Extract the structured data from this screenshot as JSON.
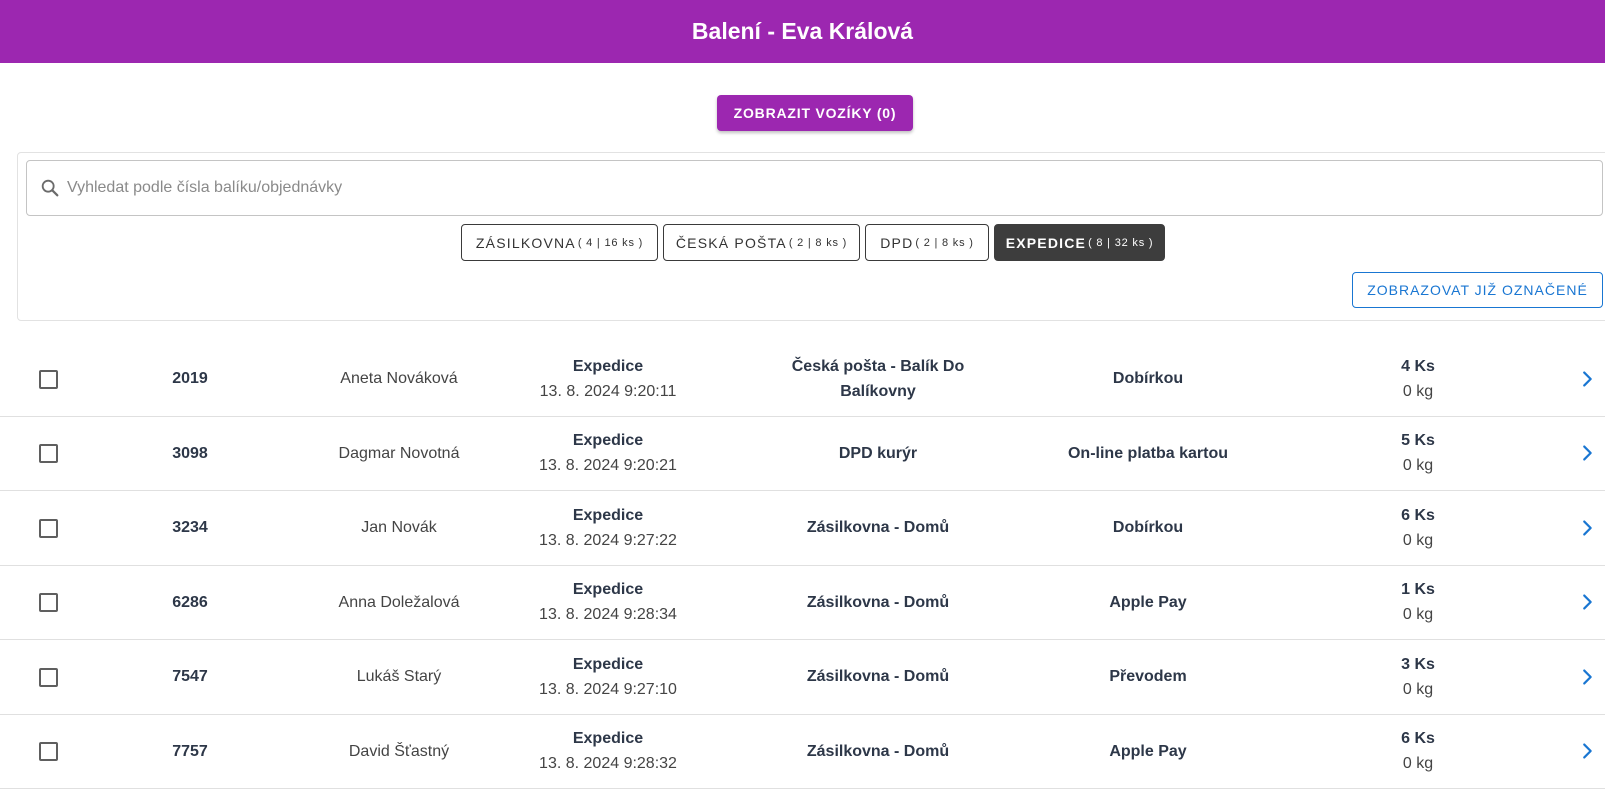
{
  "header": {
    "title": "Balení - Eva Králová"
  },
  "actions": {
    "carts_label": "ZOBRAZIT VOZÍKY (0)",
    "marked_label": "ZOBRAZOVAT JIŽ OZNAČENÉ"
  },
  "search": {
    "placeholder": "Vyhledat podle čísla balíku/objednávky",
    "value": ""
  },
  "tabs": [
    {
      "label": "ZÁSILKOVNA",
      "count": "( 4 | 16 ks )",
      "active": false
    },
    {
      "label": "ČESKÁ POŠTA",
      "count": "( 2 | 8 ks )",
      "active": false
    },
    {
      "label": "DPD",
      "count": "( 2 | 8 ks )",
      "active": false
    },
    {
      "label": "EXPEDICE",
      "count": "( 8 | 32 ks )",
      "active": true
    }
  ],
  "orders": [
    {
      "id": "2019",
      "customer": "Aneta Nováková",
      "status": "Expedice",
      "date": "13. 8. 2024 9:20:11",
      "carrier": "Česká pošta - Balík Do Balíkovny",
      "payment": "Dobírkou",
      "quantity": "4 Ks",
      "weight": "0 kg"
    },
    {
      "id": "3098",
      "customer": "Dagmar Novotná",
      "status": "Expedice",
      "date": "13. 8. 2024 9:20:21",
      "carrier": "DPD kurýr",
      "payment": "On-line platba kartou",
      "quantity": "5 Ks",
      "weight": "0 kg"
    },
    {
      "id": "3234",
      "customer": "Jan Novák",
      "status": "Expedice",
      "date": "13. 8. 2024 9:27:22",
      "carrier": "Zásilkovna - Domů",
      "payment": "Dobírkou",
      "quantity": "6 Ks",
      "weight": "0 kg"
    },
    {
      "id": "6286",
      "customer": "Anna Doležalová",
      "status": "Expedice",
      "date": "13. 8. 2024 9:28:34",
      "carrier": "Zásilkovna - Domů",
      "payment": "Apple Pay",
      "quantity": "1 Ks",
      "weight": "0 kg"
    },
    {
      "id": "7547",
      "customer": "Lukáš Starý",
      "status": "Expedice",
      "date": "13. 8. 2024 9:27:10",
      "carrier": "Zásilkovna - Domů",
      "payment": "Převodem",
      "quantity": "3 Ks",
      "weight": "0 kg"
    },
    {
      "id": "7757",
      "customer": "David Šťastný",
      "status": "Expedice",
      "date": "13. 8. 2024 9:28:32",
      "carrier": "Zásilkovna - Domů",
      "payment": "Apple Pay",
      "quantity": "6 Ks",
      "weight": "0 kg"
    }
  ],
  "colors": {
    "primary": "#9c27b0",
    "accent": "#1976d2",
    "active_tab": "#3d3d3d"
  },
  "icons": {
    "search": "search-icon",
    "row_open": "chevron-right-icon"
  }
}
